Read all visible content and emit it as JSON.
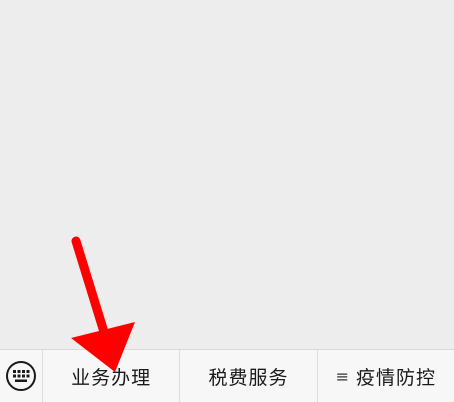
{
  "menu": {
    "keyboard_icon": "keyboard-icon",
    "items": [
      {
        "label": "业务办理",
        "prefix": ""
      },
      {
        "label": "税费服务",
        "prefix": ""
      },
      {
        "label": "疫情防控",
        "prefix": "≡"
      }
    ]
  },
  "annotation": {
    "arrow_color": "#ff0000"
  }
}
